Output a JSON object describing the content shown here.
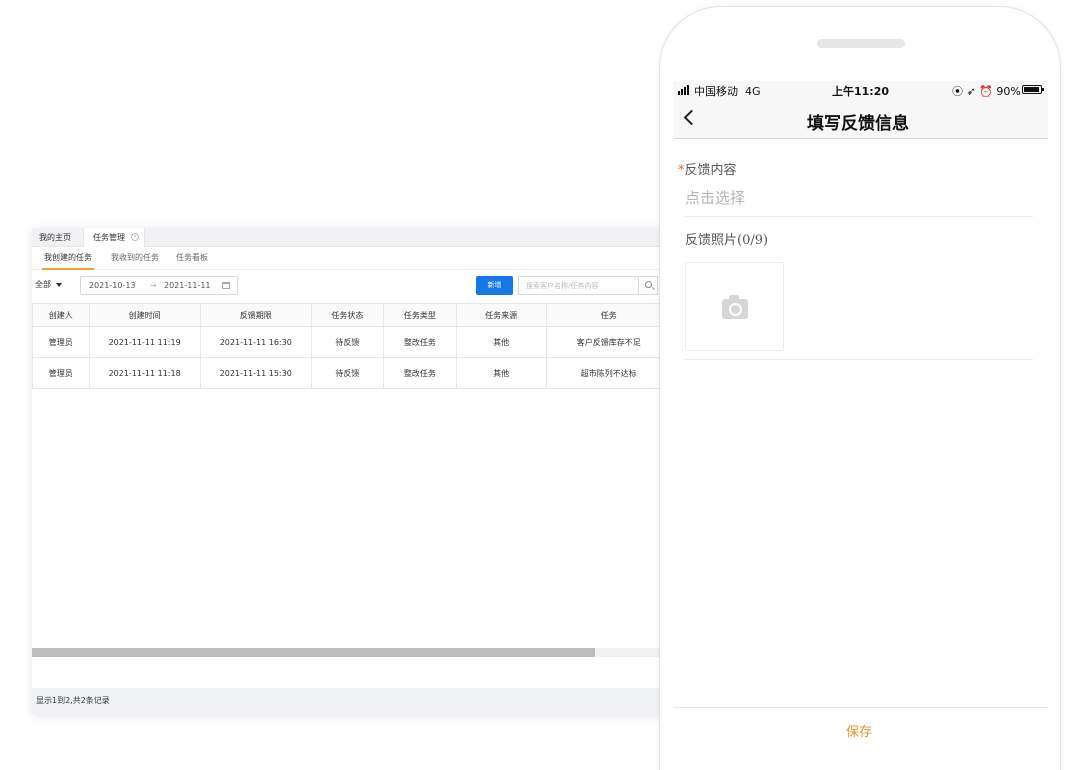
{
  "desktop": {
    "top_tabs": [
      {
        "label": "我的主页"
      },
      {
        "label": "任务管理"
      }
    ],
    "sub_tabs": [
      {
        "label": "我创建的任务"
      },
      {
        "label": "我收到的任务"
      },
      {
        "label": "任务看板"
      }
    ],
    "filter": {
      "selected": "全部",
      "date_start": "2021-10-13",
      "date_sep": "→",
      "date_end": "2021-11-11"
    },
    "add_button": "新增",
    "search": {
      "placeholder": "搜索客户名称/任务内容",
      "value": ""
    },
    "columns": [
      "创建人",
      "创建时间",
      "反馈期限",
      "任务状态",
      "任务类型",
      "任务来源",
      "任务"
    ],
    "rows": [
      [
        "管理员",
        "2021-11-11 11:19",
        "2021-11-11 16:30",
        "待反馈",
        "整改任务",
        "其他",
        "客户反馈库存不足"
      ],
      [
        "管理员",
        "2021-11-11 11:18",
        "2021-11-11 15:30",
        "待反馈",
        "整改任务",
        "其他",
        "超市陈列不达标"
      ]
    ],
    "footer": "显示1到2,共2条记录"
  },
  "phone": {
    "status": {
      "carrier": "中国移动",
      "network": "4G",
      "time": "上午11:20",
      "indicators": "⦿ ➶ ⏰ 90%"
    },
    "title": "填写反馈信息",
    "field": {
      "required_mark": "*",
      "label": "反馈内容",
      "placeholder": "点击选择"
    },
    "photo": {
      "label": "反馈照片",
      "count": "(0/9)"
    },
    "save_label": "保存"
  },
  "colors": {
    "accent_blue": "#1677e6",
    "tab_orange": "#f0a131",
    "save_orange": "#e8922a",
    "required_red": "#e8612c"
  }
}
